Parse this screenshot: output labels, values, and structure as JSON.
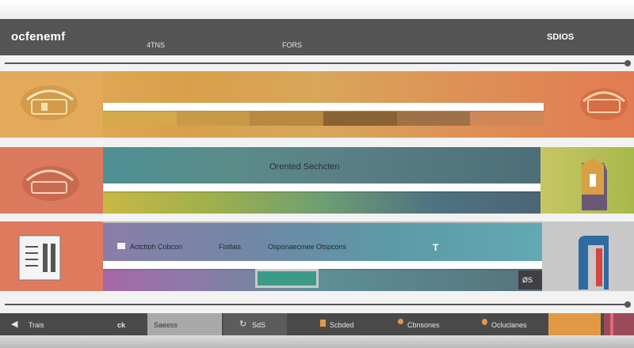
{
  "header": {
    "brand": "ocfenemf",
    "nav": [
      "4TNS",
      "FORS"
    ],
    "status": "SDIOS"
  },
  "rows": [
    {
      "band_colors": [
        "#d3a94a",
        "#c79a49",
        "#b8893e",
        "#8a6233",
        "#9e7246",
        "#cf8757"
      ]
    },
    {
      "panel_title": "Orented Sechcten"
    },
    {
      "fields": [
        "Actcttoh Cobcon",
        "Fistlais",
        "Osponaecmee Otspcons"
      ],
      "marker": "T",
      "badge": "ØS"
    }
  ],
  "bottom": {
    "items": [
      "Trais",
      "ck",
      "Saeess",
      "SdS",
      "Scbded",
      "Cbnsones",
      "Ocluclanes"
    ]
  },
  "colors": {
    "header": "#555555",
    "bottom_bar": "#4a4a4a",
    "accent_orange": "#e0a04a",
    "accent_teal": "#4f9095",
    "accent_red": "#dc7a5e"
  }
}
